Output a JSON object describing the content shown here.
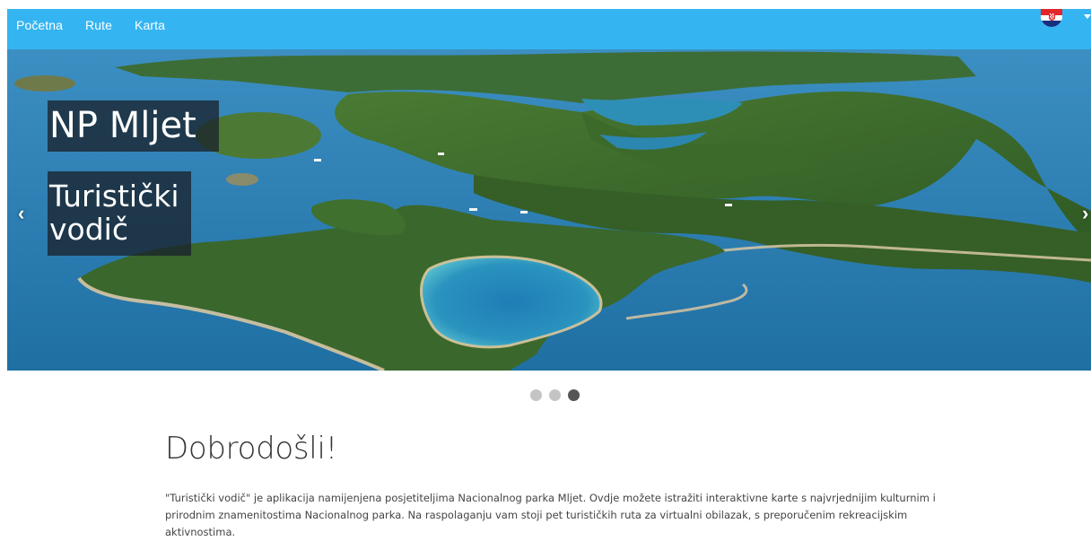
{
  "nav": {
    "links": [
      "Početna",
      "Rute",
      "Karta"
    ],
    "language_flag": "croatia-flag-icon"
  },
  "carousel": {
    "title": "NP Mljet",
    "subtitle_line1": "Turistički",
    "subtitle_line2": "vodič",
    "prev_glyph": "‹",
    "next_glyph": "›",
    "slide_count": 3,
    "active_slide": 3
  },
  "content": {
    "heading": "Dobrodošli!",
    "paragraph": "\"Turistički vodič\" je aplikacija namijenjena posjetiteljima Nacionalnog parka Mljet. Ovdje možete istražiti interaktivne karte s najvrjednijim kulturnim i prirodnim znamenitostima Nacionalnog parka. Na raspolaganju vam stoji pet turističkih ruta za virtualni obilazak, s preporučenim rekreacijskim aktivnostima."
  },
  "colors": {
    "navbar": "#35b4f2",
    "sea": "#2b7fb3",
    "forest": "#3f6a2c",
    "dot_active": "#555555",
    "dot_inactive": "#c4c4c4"
  }
}
